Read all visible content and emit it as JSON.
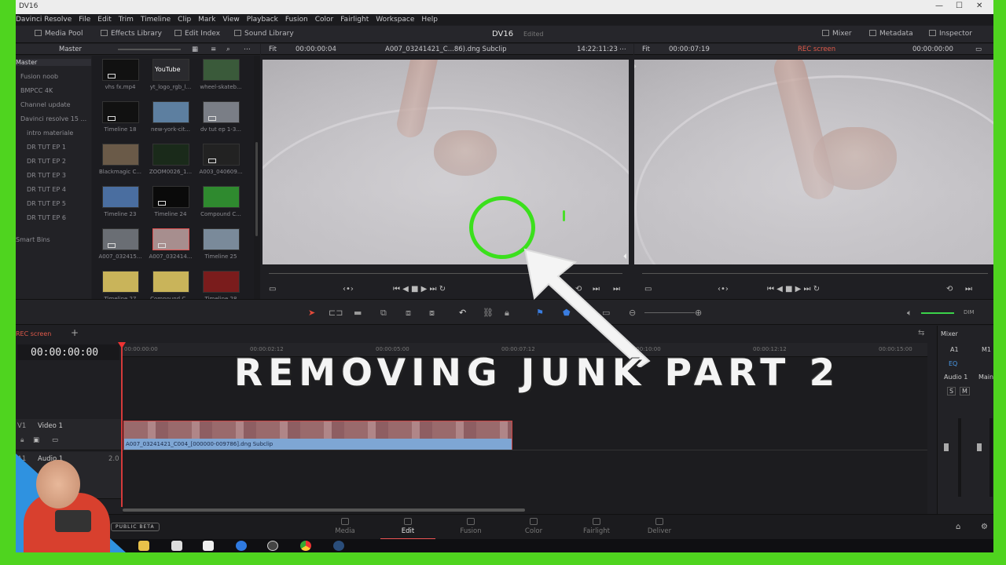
{
  "window": {
    "title": "DV16"
  },
  "menu": [
    "Davinci Resolve",
    "File",
    "Edit",
    "Trim",
    "Timeline",
    "Clip",
    "Mark",
    "View",
    "Playback",
    "Fusion",
    "Color",
    "Fairlight",
    "Workspace",
    "Help"
  ],
  "toolbar": {
    "media_pool": "Media Pool",
    "effects_library": "Effects Library",
    "edit_index": "Edit Index",
    "sound_library": "Sound Library",
    "project_title": "DV16",
    "project_status": "Edited",
    "mixer": "Mixer",
    "metadata": "Metadata",
    "inspector": "Inspector"
  },
  "pool_header": {
    "bin": "Master"
  },
  "source_viewer": {
    "zoom": "Fit",
    "timecode": "00:00:00:04",
    "clip_name": "A007_03241421_C...86).dng Subclip",
    "duration": "14:22:11:23"
  },
  "program_viewer": {
    "zoom": "Fit",
    "timecode": "00:00:07:19",
    "timeline_name": "REC screen",
    "timecode_end": "00:00:00:00"
  },
  "bins": {
    "master": "Master",
    "items": [
      {
        "label": "Fusion noob",
        "indent": false
      },
      {
        "label": "BMPCC 4K",
        "indent": false
      },
      {
        "label": "Channel update",
        "indent": false
      },
      {
        "label": "Davinci resolve 15 ...",
        "indent": false
      },
      {
        "label": "intro materiale",
        "indent": true
      },
      {
        "label": "DR TUT EP 1",
        "indent": true
      },
      {
        "label": "DR TUT EP 2",
        "indent": true
      },
      {
        "label": "DR TUT EP 3",
        "indent": true
      },
      {
        "label": "DR TUT EP 4",
        "indent": true
      },
      {
        "label": "DR TUT EP 5",
        "indent": true
      },
      {
        "label": "DR TUT EP 6",
        "indent": true
      }
    ],
    "smart_bins": "Smart Bins"
  },
  "thumbnails": [
    {
      "caption": "vhs fx.mp4"
    },
    {
      "caption": "yt_logo_rgb_l..."
    },
    {
      "caption": "wheel-skateb..."
    },
    {
      "caption": "Timeline 18"
    },
    {
      "caption": "new-york-cit..."
    },
    {
      "caption": "dv tut ep 1-3..."
    },
    {
      "caption": "Blackmagic C..."
    },
    {
      "caption": "ZOOM0026_1..."
    },
    {
      "caption": "A003_040609..."
    },
    {
      "caption": "Timeline 23"
    },
    {
      "caption": "Timeline 24"
    },
    {
      "caption": "Compound C..."
    },
    {
      "caption": "A007_032415..."
    },
    {
      "caption": "A007_032414..."
    },
    {
      "caption": "Timeline 25"
    },
    {
      "caption": "Timeline 27"
    },
    {
      "caption": "Compound C..."
    },
    {
      "caption": "Timeline 28"
    }
  ],
  "youtube_thumb_text": "YouTube",
  "timeline": {
    "tab": "REC screen",
    "timecode": "00:00:00:00",
    "ruler": [
      "00:00:00:00",
      "00:00:02:12",
      "00:00:05:00",
      "00:00:07:12",
      "00:00:10:00",
      "00:00:12:12",
      "00:00:15:00"
    ],
    "video_track": {
      "id": "V1",
      "name": "Video 1"
    },
    "audio_track": {
      "id": "A1",
      "name": "Audio 1",
      "level": "2.0"
    },
    "clip_name": "A007_03241421_C004_[000000-009786].dng Subclip"
  },
  "mixer": {
    "title": "Mixer",
    "ch1": "A1",
    "ch2": "M1",
    "audio1": "Audio 1",
    "main": "Main",
    "eq": "EQ",
    "solo": "S",
    "mute": "M"
  },
  "pages": [
    {
      "label": "Media",
      "active": false
    },
    {
      "label": "Edit",
      "active": true
    },
    {
      "label": "Fusion",
      "active": false
    },
    {
      "label": "Color",
      "active": false
    },
    {
      "label": "Fairlight",
      "active": false
    },
    {
      "label": "Deliver",
      "active": false
    }
  ],
  "overlay": {
    "title": "REMOVING JUNK PART 2",
    "badge": "PUBLIC BETA"
  },
  "colors": {
    "frame_green": "#4fd41f",
    "marker_green": "#3be01c",
    "clip_blue": "#7ea6d4",
    "playhead_red": "#d43a3a"
  }
}
